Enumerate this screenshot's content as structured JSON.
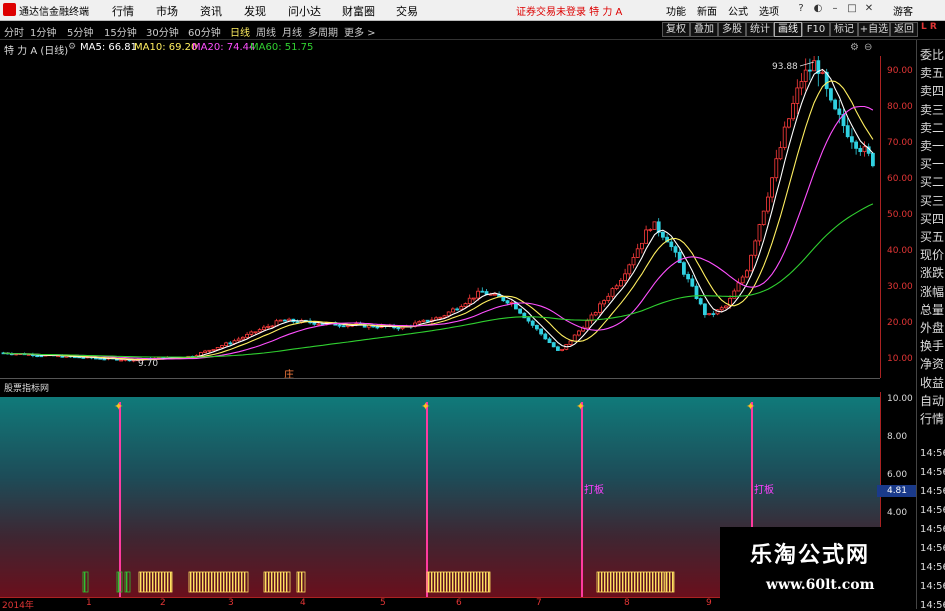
{
  "menubar": {
    "app_name": "通达信金融终端",
    "items": [
      "行情",
      "市场",
      "资讯",
      "发现",
      "问小达",
      "财富圈",
      "交易"
    ],
    "alert": "证券交易未登录  特 力 A",
    "right_items": [
      "功能",
      "新面",
      "公式",
      "选项"
    ],
    "guest": "游客"
  },
  "toolbar": {
    "periods": [
      "分时",
      "1分钟",
      "5分钟",
      "15分钟",
      "30分钟",
      "60分钟",
      "日线",
      "周线",
      "月线",
      "多周期",
      "更多 >"
    ],
    "active_period": "日线",
    "right_buttons": [
      "复权",
      "叠加",
      "多股",
      "统计",
      "画线",
      "F10",
      "标记",
      "+自选",
      "返回"
    ]
  },
  "ma_line": {
    "stock": "特 力 A (日线)",
    "ma5": "MA5: 66.81",
    "ma10": "MA10: 69.20",
    "ma20": "MA20: 74.44",
    "ma60": "MA60: 51.75"
  },
  "colors": {
    "ma5": "#ffffff",
    "ma10": "#ffef60",
    "ma20": "#ff50ff",
    "ma60": "#30d030",
    "up": "#ff3c3c",
    "down": "#30d0e0"
  },
  "main_axis": {
    "ticks": [
      "90.00",
      "80.00",
      "70.00",
      "60.00",
      "50.00",
      "40.00",
      "30.00",
      "20.00",
      "10.00"
    ]
  },
  "indicator": {
    "title": "股票指标网",
    "ticks": [
      "10.00",
      "8.00",
      "6.00",
      "4.00"
    ],
    "current": "4.81",
    "signal_label": "打板"
  },
  "annotations": {
    "high": "93.88",
    "low": "9.70",
    "stock_marker": "庄"
  },
  "x_axis": {
    "labels": [
      "2014年",
      "1",
      "2",
      "3",
      "4",
      "5",
      "6",
      "7",
      "8",
      "9"
    ]
  },
  "side_panel": {
    "items": [
      "委比",
      "卖五",
      "卖四",
      "卖三",
      "卖二",
      "卖一",
      "买一",
      "买二",
      "买三",
      "买四",
      "买五",
      "现价",
      "涨跌",
      "涨幅",
      "总量",
      "外盘",
      "换手",
      "净资",
      "收益",
      "自动",
      "行情"
    ],
    "times": [
      "14:56",
      "14:56",
      "14:56",
      "14:56",
      "14:56",
      "14:56",
      "14:56",
      "14:56",
      "14:56"
    ],
    "top_label": "L R"
  },
  "watermark": {
    "name": "乐淘公式网",
    "url": "www.60lt.com"
  }
}
